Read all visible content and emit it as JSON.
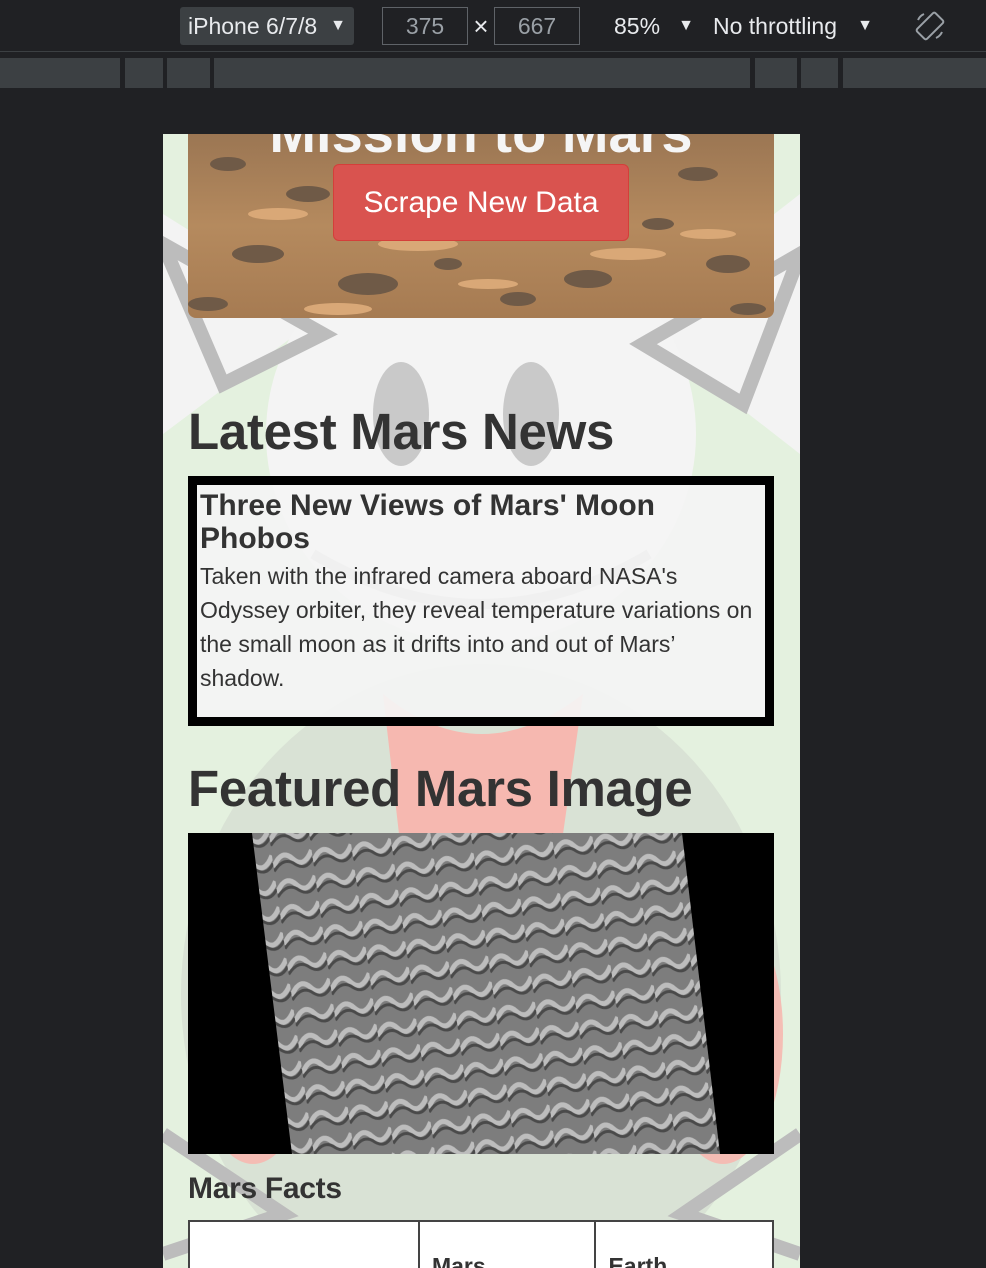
{
  "devtools": {
    "device": "iPhone 6/7/8",
    "width_value": "375",
    "height_value": "667",
    "times_symbol": "×",
    "zoom": "85%",
    "throttling": "No throttling",
    "dropdown_caret": "▼",
    "rotate_icon": "rotate-device-icon"
  },
  "page": {
    "hero": {
      "title": "Mission to Mars",
      "scrape_button": "Scrape New Data"
    },
    "news": {
      "heading": "Latest Mars News",
      "title": "Three New Views of Mars' Moon Phobos",
      "paragraph": "Taken with the infrared camera aboard NASA's Odyssey orbiter, they reveal temperature variations on the small moon as it drifts into and out of Mars’ shadow."
    },
    "featured_image": {
      "heading": "Featured Mars Image"
    },
    "facts": {
      "heading": "Mars Facts",
      "columns": [
        "",
        "Mars",
        "Earth"
      ]
    }
  },
  "colors": {
    "devtools_bg": "#202124",
    "button_red": "#d9534f",
    "page_bg": "#e4f1df",
    "text_dark": "#333333"
  }
}
